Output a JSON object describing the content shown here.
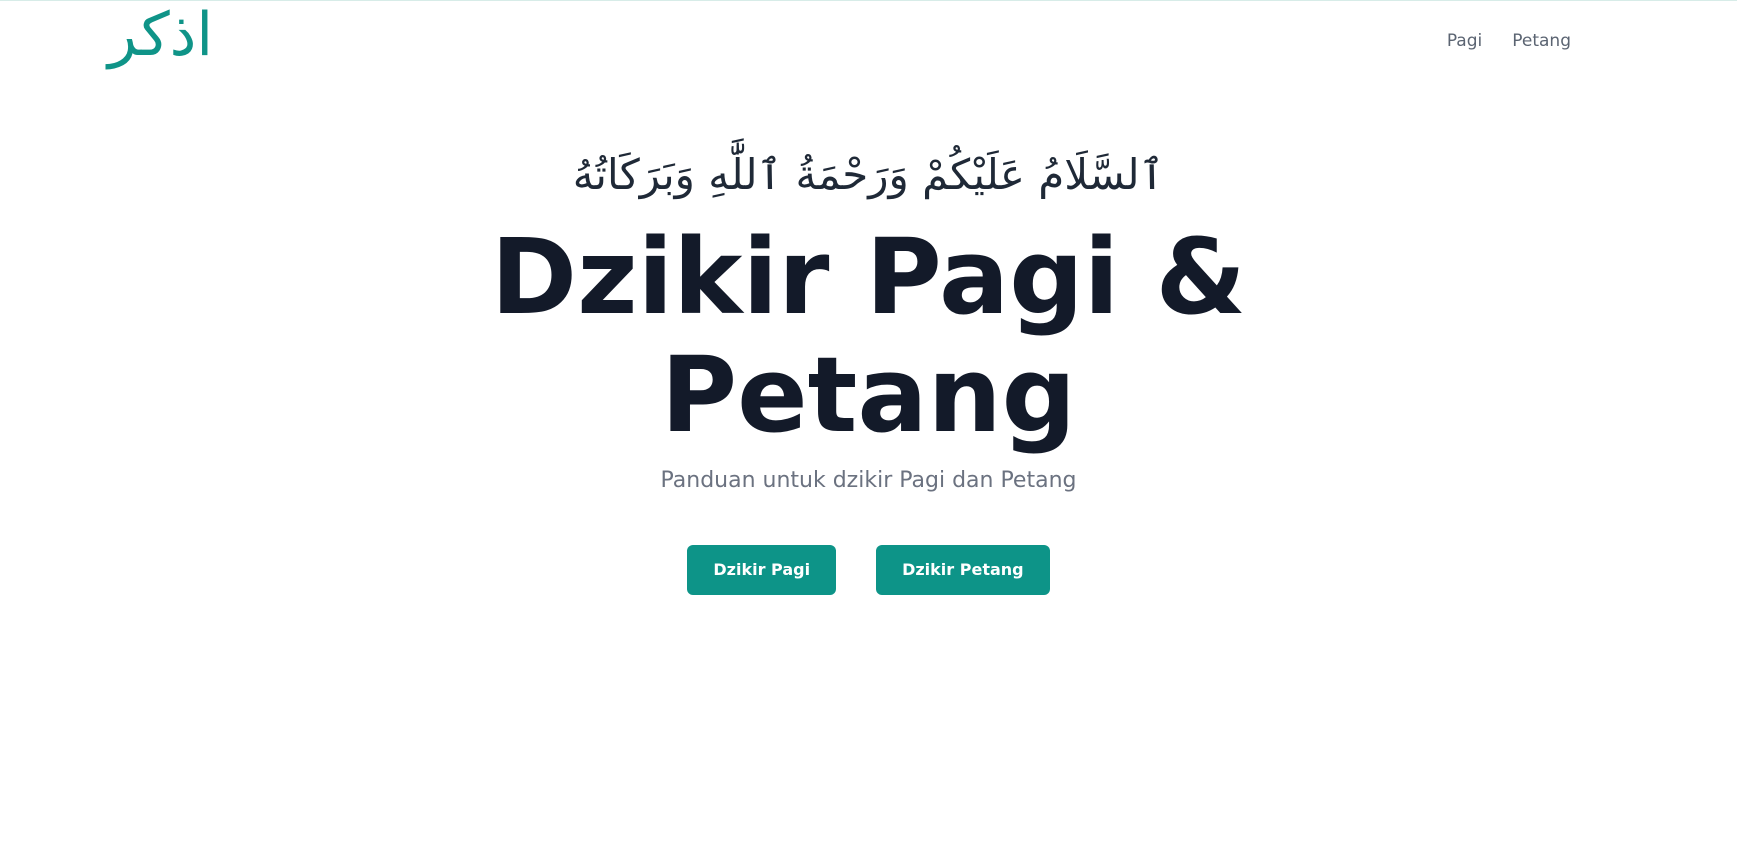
{
  "header": {
    "logo": "اذكر",
    "nav": [
      {
        "label": "Pagi"
      },
      {
        "label": "Petang"
      }
    ]
  },
  "hero": {
    "greeting": "ٱلسَّلَامُ عَلَيْكُمْ وَرَحْمَةُ ٱللَّٰهِ وَبَرَكَاتُهُ",
    "title": "Dzikir Pagi & Petang",
    "subtitle": "Panduan untuk dzikir Pagi dan Petang",
    "buttons": [
      {
        "label": "Dzikir Pagi"
      },
      {
        "label": "Dzikir Petang"
      }
    ]
  },
  "colors": {
    "accent": "#0d9488",
    "title": "#131a29",
    "muted": "#6b7280"
  }
}
